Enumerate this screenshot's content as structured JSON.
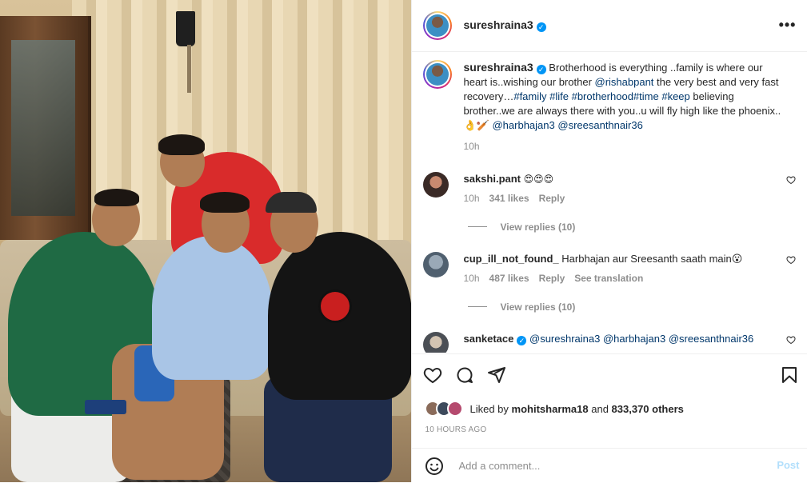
{
  "header": {
    "username": "sureshraina3",
    "verified_mark": "✓",
    "more_label": "•••"
  },
  "caption": {
    "username": "sureshraina3",
    "text_1": " Brotherhood is everything ..family is where our heart is..wishing our brother ",
    "mention_1": "@rishabpant",
    "text_2": " the very best and very fast recovery…",
    "tags": "#family #life #brotherhood#time #keep",
    "text_3": " believing brother..we are always there with you..u will fly high like the phoenix..",
    "emojis": "👌🏏",
    "mention_2": "@harbhajan3",
    "mention_3": "@sreesanthnair36",
    "time": "10h"
  },
  "comments": [
    {
      "username": "sakshi.pant",
      "text": "😍😍😍",
      "time": "10h",
      "likes": "341 likes",
      "reply": "Reply",
      "view_replies": "View replies (10)"
    },
    {
      "username": "cup_ill_not_found_",
      "text": "Harbhajan aur Sreesanth saath main😮",
      "time": "10h",
      "likes": "487 likes",
      "reply": "Reply",
      "translate": "See translation",
      "view_replies": "View replies (10)"
    },
    {
      "username": "sanketace",
      "text": "@sureshraina3 @harbhajan3 @sreesanthnair36"
    }
  ],
  "actions": {
    "liked_by_prefix": "Liked by ",
    "liked_by_user": "mohitsharma18",
    "liked_by_suffix": " and ",
    "others": "833,370 others",
    "timestamp": "10 HOURS AGO"
  },
  "add_comment": {
    "placeholder": "Add a comment...",
    "post_label": "Post"
  },
  "icons": {
    "header_avatar": "profile-avatar",
    "like": "heart-icon",
    "comment": "comment-icon",
    "share": "share-icon",
    "save": "bookmark-icon",
    "emoji": "emoji-icon"
  },
  "colors": {
    "verified": "#0095f6",
    "link": "#00376b",
    "muted": "#8e8e8e",
    "post_button": "#b2dffc"
  }
}
